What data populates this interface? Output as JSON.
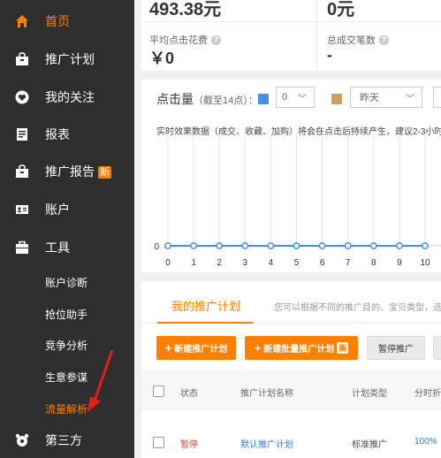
{
  "sidebar": {
    "items": [
      {
        "label": "首页",
        "icon": "home-icon",
        "active": true
      },
      {
        "label": "推广计划",
        "icon": "bag-icon"
      },
      {
        "label": "我的关注",
        "icon": "heart-icon"
      },
      {
        "label": "报表",
        "icon": "report-icon"
      },
      {
        "label": "推广报告",
        "icon": "bag-icon",
        "badge": "新"
      },
      {
        "label": "账户",
        "icon": "id-card-icon"
      },
      {
        "label": "工具",
        "icon": "briefcase-icon"
      }
    ],
    "tools_sub": [
      {
        "label": "账户诊断"
      },
      {
        "label": "抢位助手"
      },
      {
        "label": "竞争分析"
      },
      {
        "label": "生意参谋"
      },
      {
        "label": "流量解析",
        "active": true
      }
    ],
    "third_party": {
      "label": "第三方",
      "icon": "third-party-icon"
    }
  },
  "stats": {
    "top_left_value": "493.38元",
    "top_right_value": "0元",
    "avg_click_cost_label": "平均点击花费",
    "avg_click_cost_value": "￥0",
    "total_deals_label": "总成交笔数",
    "total_deals_value": "-"
  },
  "chart_header": {
    "title": "点击量",
    "subtitle": "（截至14点）：",
    "metric_select": "0",
    "compare_select": "昨天",
    "primary_color": "#4a90e2",
    "compare_color": "#c8a064",
    "note": "实时效果数据（成交、收藏、加购）将会在点击后持续产生，建议2-3小时"
  },
  "chart_data": {
    "type": "line",
    "x": [
      0,
      1,
      2,
      3,
      4,
      5,
      6,
      7,
      8,
      9,
      10
    ],
    "series": [
      {
        "values": [
          0,
          0,
          0,
          0,
          0,
          0,
          0,
          0,
          0,
          0,
          0
        ]
      }
    ],
    "y_tick_labels": [
      "0"
    ]
  },
  "campaigns": {
    "tab_label": "我的推广计划",
    "tab_hint": "您可以根据不同的推广目的、宝贝类型，选",
    "btn_new": "新建推广计划",
    "btn_batch_new": "新建批量推广计划",
    "btn_batch_badge": "新",
    "btn_pause": "暂停推广",
    "columns": [
      "状态",
      "推广计划名称",
      "计划类型",
      "分时折"
    ],
    "rows": [
      {
        "status": "暂停",
        "name": "默认推广计划",
        "type": "标准推广",
        "discount": "100%"
      }
    ],
    "status_color": "#e4393c",
    "link_color": "#3d7bc6"
  }
}
